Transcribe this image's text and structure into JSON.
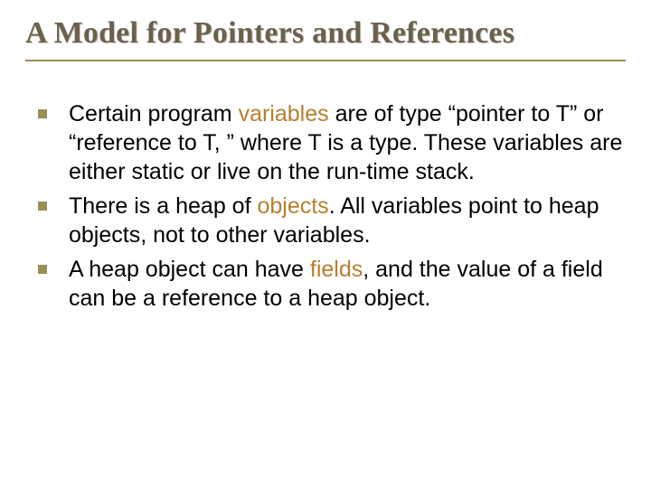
{
  "colors": {
    "title": "#6a614e",
    "accent_rule": "#9a8f56",
    "bullet_square": "#9a8f56",
    "highlight": "#b77f2f",
    "body_text": "#000000"
  },
  "title": "A Model for Pointers and References",
  "bullets": [
    {
      "parts": [
        {
          "text": "Certain program ",
          "hl": false
        },
        {
          "text": "variables",
          "hl": true
        },
        {
          "text": " are of type “pointer to T” or “reference to T, ” where T is a type. These variables are either static or live on the run-time stack.",
          "hl": false
        }
      ]
    },
    {
      "parts": [
        {
          "text": "There is a heap of ",
          "hl": false
        },
        {
          "text": "objects",
          "hl": true
        },
        {
          "text": ". All variables point to heap objects, not to other variables.",
          "hl": false
        }
      ]
    },
    {
      "parts": [
        {
          "text": "A heap object can have ",
          "hl": false
        },
        {
          "text": "fields",
          "hl": true
        },
        {
          "text": ", and the value of a field can be a reference to a heap object.",
          "hl": false
        }
      ]
    }
  ]
}
